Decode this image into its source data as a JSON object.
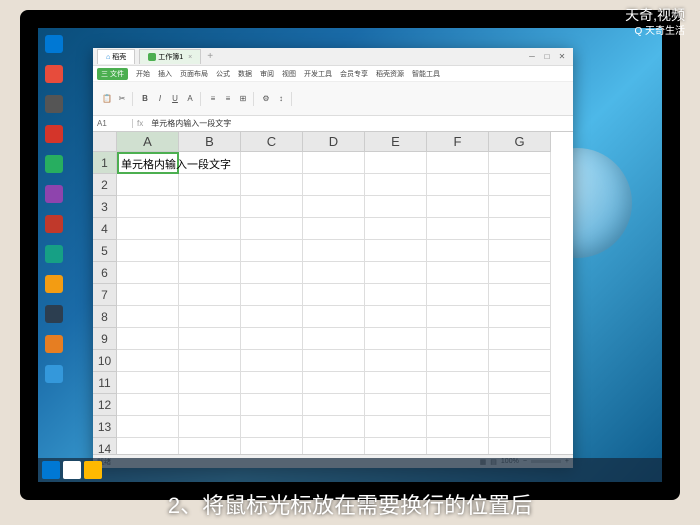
{
  "watermark": {
    "line1": "天奇,视频",
    "line2": "Q 天奇生活"
  },
  "caption": "2、将鼠标光标放在需要换行的位置后",
  "window": {
    "tabs": [
      {
        "label": "稻壳"
      },
      {
        "label": "工作簿1"
      }
    ],
    "menu": [
      "开始",
      "插入",
      "页面布局",
      "公式",
      "数据",
      "审阅",
      "视图",
      "开发工具",
      "会员专享",
      "稻壳资源",
      "智能工具"
    ],
    "formula": {
      "cell": "A1",
      "content": "单元格内输入一段文字"
    },
    "columns": [
      "A",
      "B",
      "C",
      "D",
      "E",
      "F",
      "G"
    ],
    "rows_count": 14,
    "cell_a1": "单元格内输入一段文字",
    "status": {
      "left": "就绪",
      "zoom": "100%"
    }
  },
  "desktop_colors": [
    "#0078d4",
    "#e74c3c",
    "#555",
    "#d4352a",
    "#27ae60",
    "#8e44ad",
    "#c0392b",
    "#16a085",
    "#f39c12",
    "#2c3e50",
    "#e67e22",
    "#3498db"
  ]
}
